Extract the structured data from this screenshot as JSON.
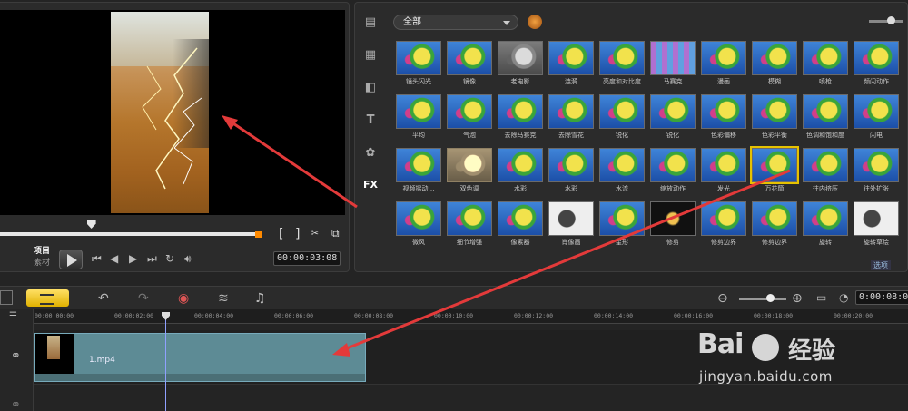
{
  "preview": {
    "mode_project": "项目",
    "mode_clip": "素材",
    "timecode": "00:00:03:08",
    "trim_in": "[",
    "trim_out": "]",
    "progress_fraction": 0.34
  },
  "library": {
    "filter_category": "全部",
    "tools": [
      "media-icon",
      "instant-project-icon",
      "transition-icon",
      "title-icon",
      "graphic-icon",
      "FX"
    ],
    "effects": [
      {
        "label": "镜头闪光",
        "style": ""
      },
      {
        "label": "镜像",
        "style": ""
      },
      {
        "label": "老电影",
        "style": "gray"
      },
      {
        "label": "涟漪",
        "style": ""
      },
      {
        "label": "亮度和对比度",
        "style": ""
      },
      {
        "label": "马赛克",
        "style": "mosaic"
      },
      {
        "label": "漫画",
        "style": ""
      },
      {
        "label": "模糊",
        "style": ""
      },
      {
        "label": "喷枪",
        "style": ""
      },
      {
        "label": "频闪动作",
        "style": ""
      },
      {
        "label": "平均",
        "style": ""
      },
      {
        "label": "气泡",
        "style": ""
      },
      {
        "label": "去除马赛克",
        "style": ""
      },
      {
        "label": "去除雪花",
        "style": ""
      },
      {
        "label": "锐化",
        "style": ""
      },
      {
        "label": "锐化",
        "style": ""
      },
      {
        "label": "色彩偏移",
        "style": ""
      },
      {
        "label": "色彩平衡",
        "style": ""
      },
      {
        "label": "色调和饱和度",
        "style": ""
      },
      {
        "label": "闪电",
        "style": ""
      },
      {
        "label": "视频摇动…",
        "style": ""
      },
      {
        "label": "双色调",
        "style": "sepia"
      },
      {
        "label": "水彩",
        "style": ""
      },
      {
        "label": "水彩",
        "style": ""
      },
      {
        "label": "水流",
        "style": ""
      },
      {
        "label": "缩放动作",
        "style": ""
      },
      {
        "label": "发光",
        "style": ""
      },
      {
        "label": "万花筒",
        "style": "sel"
      },
      {
        "label": "往内挤压",
        "style": ""
      },
      {
        "label": "往外扩张",
        "style": ""
      },
      {
        "label": "微风",
        "style": ""
      },
      {
        "label": "细节增强",
        "style": ""
      },
      {
        "label": "像素器",
        "style": ""
      },
      {
        "label": "肖像画",
        "style": "white"
      },
      {
        "label": "星形",
        "style": ""
      },
      {
        "label": "修剪",
        "style": "dark"
      },
      {
        "label": "修剪边界",
        "style": ""
      },
      {
        "label": "修剪边界",
        "style": ""
      },
      {
        "label": "旋转",
        "style": ""
      },
      {
        "label": "旋转草绘",
        "style": "white"
      }
    ],
    "scroll_button": "选项"
  },
  "timeline": {
    "ruler_ticks": [
      "00:00:00:00",
      "00:00:02:00",
      "00:00:04:00",
      "00:00:06:00",
      "00:00:08:00",
      "00:00:10:00",
      "00:00:12:00",
      "00:00:14:00",
      "00:00:16:00",
      "00:00:18:00",
      "00:00:20:00"
    ],
    "timecode": "0:00:08:00",
    "clip_name": "1.mp4",
    "playhead_seconds": 3.3
  },
  "watermark": {
    "logo": "Bai",
    "cn": "经验",
    "url": "jingyan.baidu.com"
  },
  "colors": {
    "accent": "#e0b100",
    "clip": "#5d8b95",
    "annotation_arrow": "#e33a3a"
  }
}
